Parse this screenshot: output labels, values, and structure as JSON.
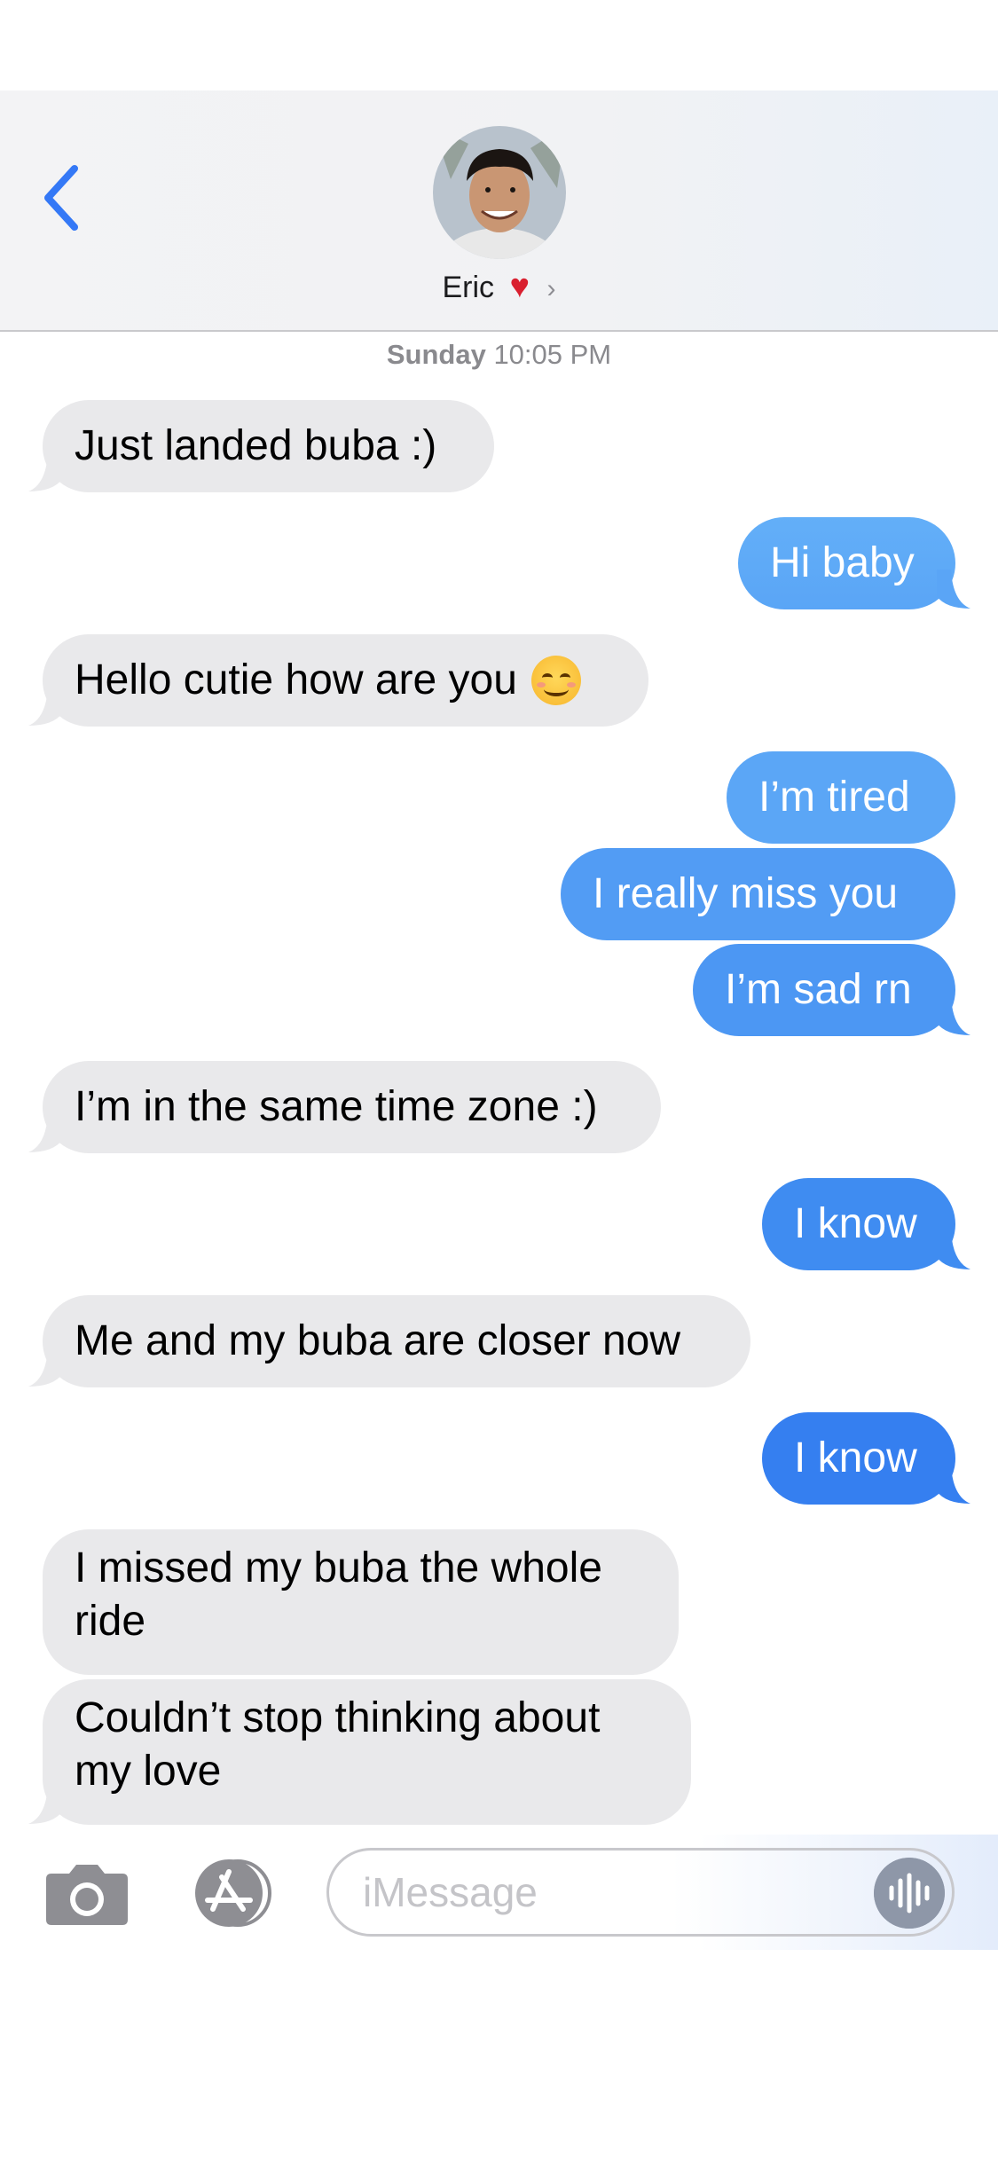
{
  "header": {
    "contact_name": "Eric",
    "heart": "♥",
    "chevron": "›",
    "accent": "#3478f6"
  },
  "thread": {
    "timestamp_day": "Sunday",
    "timestamp_time": "10:05 PM",
    "messages": [
      {
        "dir": "in",
        "text": "Just landed buba :)"
      },
      {
        "dir": "out",
        "text": "Hi baby"
      },
      {
        "dir": "in",
        "text": "Hello cutie how are you",
        "emoji": "smiling-face-icon"
      },
      {
        "dir": "out",
        "text": "I’m tired"
      },
      {
        "dir": "out",
        "text": "I really miss you"
      },
      {
        "dir": "out",
        "text": "I’m sad rn"
      },
      {
        "dir": "in",
        "text": "I’m in the same time zone :)"
      },
      {
        "dir": "out",
        "text": "I know"
      },
      {
        "dir": "in",
        "text": "Me and my buba are closer now"
      },
      {
        "dir": "out",
        "text": "I know"
      },
      {
        "dir": "in",
        "text": "I missed my buba the whole ride"
      },
      {
        "dir": "in",
        "text": "Couldn’t stop thinking about my love"
      }
    ]
  },
  "composer": {
    "placeholder": "iMessage"
  },
  "colors": {
    "incoming_bubble": "#e9e9eb",
    "outgoing_top": "#62adf7",
    "outgoing_bottom": "#2f7fee"
  }
}
